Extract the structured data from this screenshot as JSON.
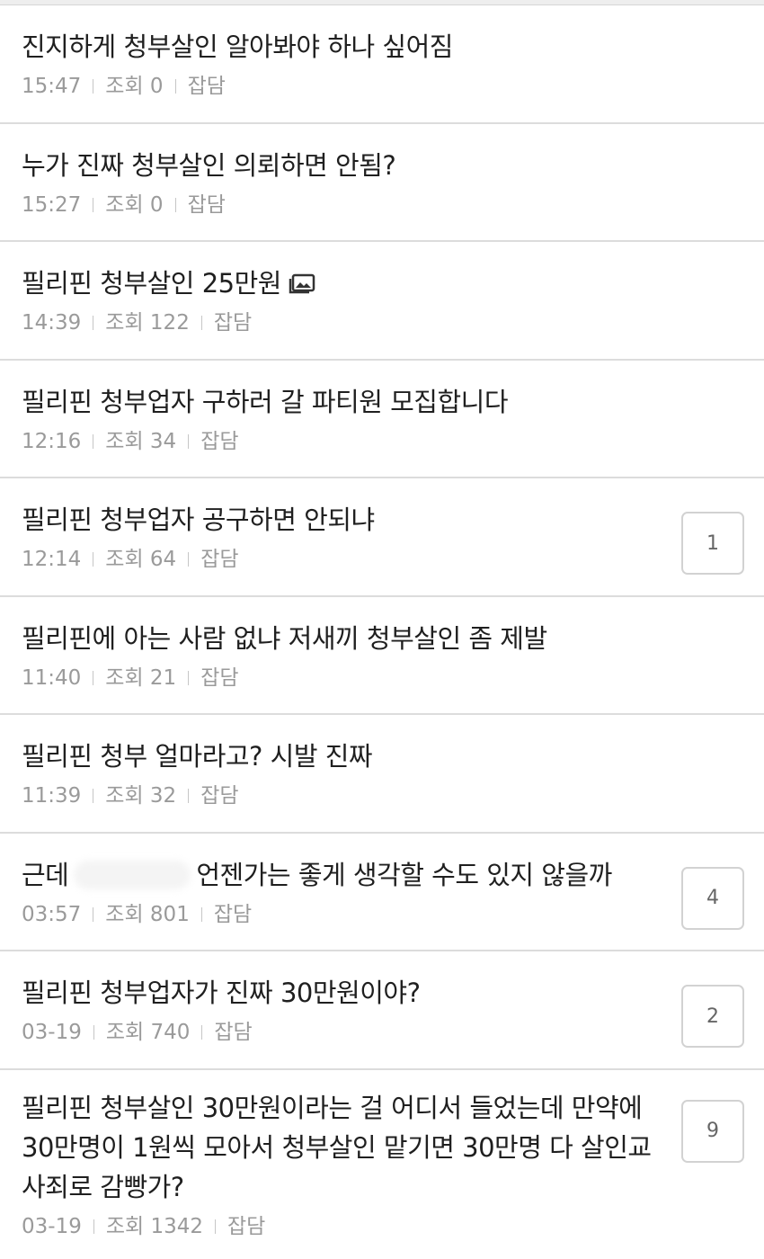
{
  "posts": [
    {
      "title": "진지하게 청부살인 알아봐야 하나 싶어짐",
      "time": "15:47",
      "views": "조회 0",
      "category": "잡담",
      "comments": null,
      "has_image": false
    },
    {
      "title": "누가 진짜 청부살인 의뢰하면 안됨?",
      "time": "15:27",
      "views": "조회 0",
      "category": "잡담",
      "comments": null,
      "has_image": false
    },
    {
      "title": "필리핀 청부살인 25만원",
      "time": "14:39",
      "views": "조회 122",
      "category": "잡담",
      "comments": null,
      "has_image": true
    },
    {
      "title": "필리핀 청부업자 구하러 갈 파티원 모집합니다",
      "time": "12:16",
      "views": "조회 34",
      "category": "잡담",
      "comments": null,
      "has_image": false
    },
    {
      "title": "필리핀 청부업자 공구하면 안되냐",
      "time": "12:14",
      "views": "조회 64",
      "category": "잡담",
      "comments": "1",
      "has_image": false
    },
    {
      "title": "필리핀에 아는 사람 없냐 저새끼 청부살인 좀 제발",
      "time": "11:40",
      "views": "조회 21",
      "category": "잡담",
      "comments": null,
      "has_image": false
    },
    {
      "title": "필리핀 청부 얼마라고? 시발 진짜",
      "time": "11:39",
      "views": "조회 32",
      "category": "잡담",
      "comments": null,
      "has_image": false
    },
    {
      "title_before": "근데",
      "title_after": "언젠가는 좋게 생각할 수도 있지 않을까",
      "time": "03:57",
      "views": "조회 801",
      "category": "잡담",
      "comments": "4",
      "has_image": false
    },
    {
      "title": "필리핀 청부업자가 진짜 30만원이야?",
      "time": "03-19",
      "views": "조회 740",
      "category": "잡담",
      "comments": "2",
      "has_image": false
    },
    {
      "title": "필리핀 청부살인 30만원이라는 걸 어디서 들었는데 만약에 30만명이 1원씩 모아서 청부살인 맡기면 30만명 다 살인교사죄로 감빵가?",
      "time": "03-19",
      "views": "조회 1342",
      "category": "잡담",
      "comments": "9",
      "has_image": false
    }
  ]
}
